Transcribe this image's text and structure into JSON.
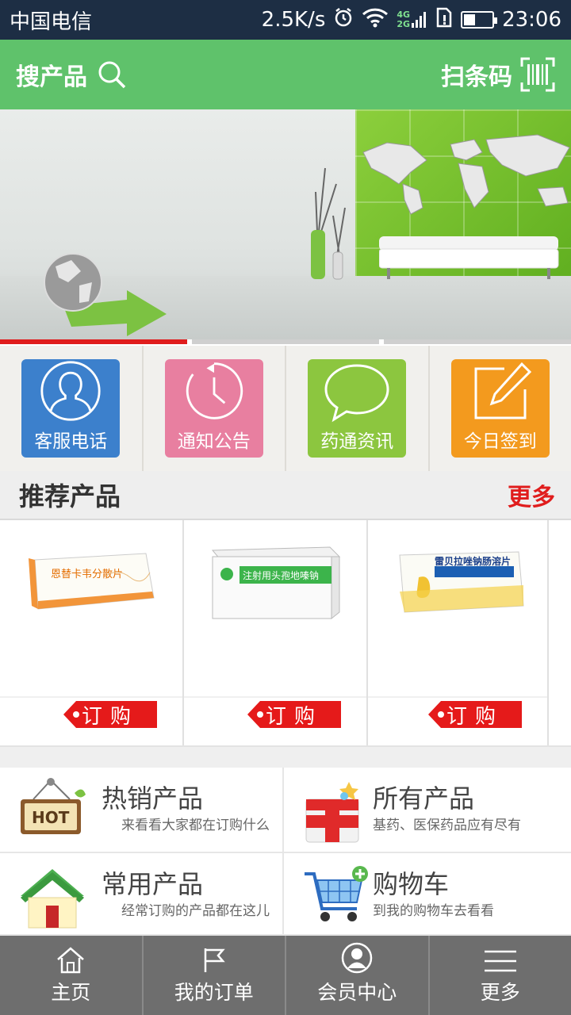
{
  "status_bar": {
    "carrier": "中国电信",
    "net_speed": "2.5K/s",
    "net_type_top": "4G",
    "net_type_bottom": "2G",
    "time": "23:06"
  },
  "header": {
    "search_label": "搜产品",
    "scan_label": "扫条码"
  },
  "banner": {
    "slides": 3,
    "active_slide": 1
  },
  "tiles": [
    {
      "label": "客服电话",
      "icon": "user-icon",
      "color": "#3c80cc"
    },
    {
      "label": "通知公告",
      "icon": "clock-icon",
      "color": "#e87fa0"
    },
    {
      "label": "药通资讯",
      "icon": "chat-icon",
      "color": "#8cc63f"
    },
    {
      "label": "今日签到",
      "icon": "edit-icon",
      "color": "#f39a1e"
    }
  ],
  "recommended": {
    "title": "推荐产品",
    "more": "更多",
    "products": [
      {
        "name": "恩替卡韦分散片",
        "order_label": "订购"
      },
      {
        "name": "注射用头孢地嗪钠",
        "order_label": "订购"
      },
      {
        "name": "雷贝拉唑钠肠溶片",
        "order_label": "订购"
      }
    ]
  },
  "categories": [
    {
      "name": "热销产品",
      "desc": "来看看大家都在订购什么",
      "icon": "hot-sign-icon",
      "icon_text": "HOT"
    },
    {
      "name": "所有产品",
      "desc": "基药、医保药品应有尽有",
      "icon": "medical-kit-icon"
    },
    {
      "name": "常用产品",
      "desc": "经常订购的产品都在这儿",
      "icon": "house-icon"
    },
    {
      "name": "购物车",
      "desc": "到我的购物车去看看",
      "icon": "cart-icon"
    }
  ],
  "bottom_nav": [
    {
      "label": "主页",
      "icon": "home-icon"
    },
    {
      "label": "我的订单",
      "icon": "flag-icon"
    },
    {
      "label": "会员中心",
      "icon": "member-icon"
    },
    {
      "label": "更多",
      "icon": "menu-icon"
    }
  ]
}
